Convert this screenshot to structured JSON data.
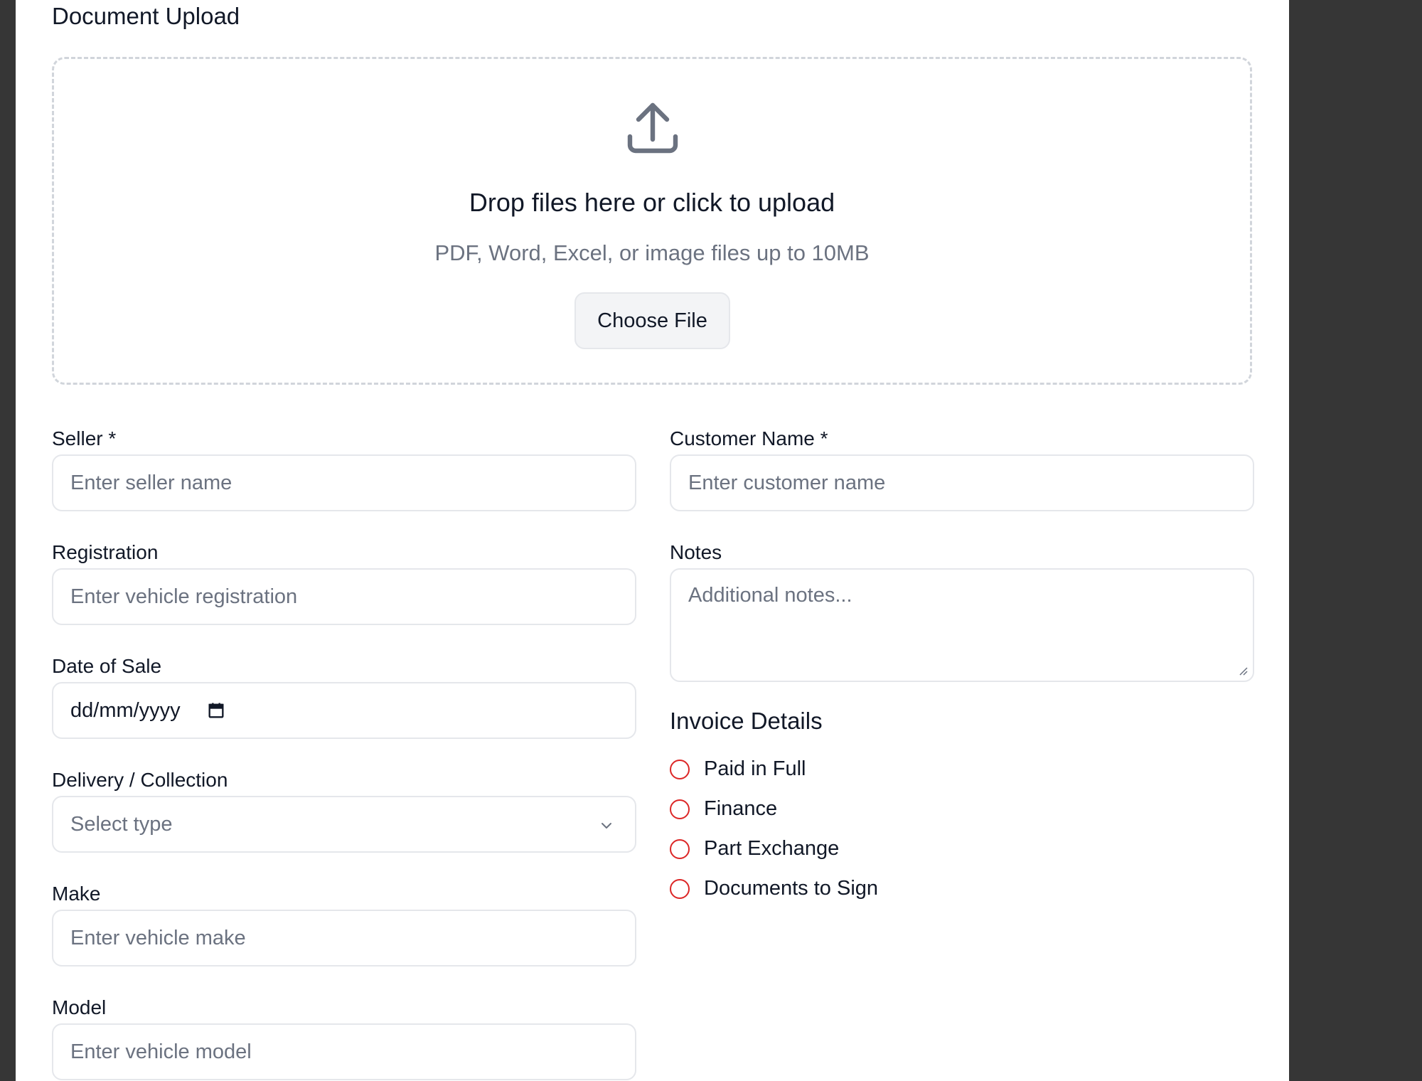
{
  "upload": {
    "section_title": "Document Upload",
    "drop_title": "Drop files here or click to upload",
    "drop_hint": "PDF, Word, Excel, or image files up to 10MB",
    "choose_file_label": "Choose File",
    "icon": "upload-icon"
  },
  "form": {
    "seller": {
      "label": "Seller *",
      "placeholder": "Enter seller name"
    },
    "customer_name": {
      "label": "Customer Name *",
      "placeholder": "Enter customer name"
    },
    "registration": {
      "label": "Registration",
      "placeholder": "Enter vehicle registration"
    },
    "notes": {
      "label": "Notes",
      "placeholder": "Additional notes..."
    },
    "date_of_sale": {
      "label": "Date of Sale",
      "value": "dd/mm/yyyy",
      "icon": "calendar-icon"
    },
    "delivery_collection": {
      "label": "Delivery / Collection",
      "selected": "Select type",
      "icon": "chevron-down-icon"
    },
    "make": {
      "label": "Make",
      "placeholder": "Enter vehicle make"
    },
    "model": {
      "label": "Model",
      "placeholder": "Enter vehicle model"
    }
  },
  "invoice": {
    "title": "Invoice Details",
    "options": [
      {
        "label": "Paid in Full"
      },
      {
        "label": "Finance"
      },
      {
        "label": "Part Exchange"
      },
      {
        "label": "Documents to Sign"
      }
    ]
  },
  "colors": {
    "radio_border": "#dc2626",
    "page_bg": "#363636",
    "panel_bg": "#ffffff",
    "muted_text": "#6b7280",
    "border": "#e5e7eb"
  }
}
